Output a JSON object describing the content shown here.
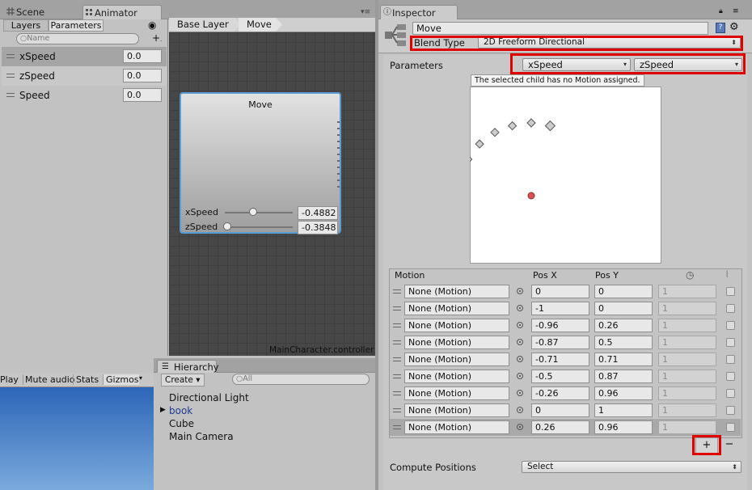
{
  "tabs": {
    "scene": "Scene",
    "animator": "Animator",
    "inspector": "Inspector",
    "hierarchy": "Hierarchy"
  },
  "animator": {
    "subtabs": {
      "layers": "Layers",
      "parameters": "Parameters"
    },
    "search_placeholder": "Name",
    "params": [
      {
        "name": "xSpeed",
        "value": "0.0"
      },
      {
        "name": "zSpeed",
        "value": "0.0"
      },
      {
        "name": "Speed",
        "value": "0.0"
      }
    ],
    "breadcrumb": [
      "Base Layer",
      "Move"
    ],
    "node": {
      "title": "Move",
      "sliders": [
        {
          "label": "xSpeed",
          "value": "-0.4882",
          "pos": 0.3
        },
        {
          "label": "zSpeed",
          "value": "-0.3848",
          "pos": 0.0
        }
      ]
    },
    "controller": "MainCharacter.controller"
  },
  "game_toolbar": {
    "play": "Play",
    "mute": "Mute audio",
    "stats": "Stats",
    "gizmos": "Gizmos"
  },
  "hierarchy": {
    "create": "Create",
    "search_placeholder": "All",
    "items": [
      "Directional Light",
      "book",
      "Cube",
      "Main Camera"
    ]
  },
  "inspector": {
    "name": "Move",
    "blend_type_label": "Blend Type",
    "blend_type": "2D Freeform Directional",
    "parameters_label": "Parameters",
    "param_x": "xSpeed",
    "param_y": "zSpeed",
    "warning": "The selected child has no Motion assigned.",
    "points": [
      [
        0,
        0
      ],
      [
        -1,
        0
      ],
      [
        -0.96,
        0.26
      ],
      [
        -0.87,
        0.5
      ],
      [
        -0.71,
        0.71
      ],
      [
        -0.5,
        0.87
      ],
      [
        -0.26,
        0.96
      ],
      [
        0,
        1
      ],
      [
        0.26,
        0.96
      ]
    ],
    "table_headers": {
      "motion": "Motion",
      "posx": "Pos X",
      "posy": "Pos Y"
    },
    "rows": [
      {
        "motion": "None (Motion)",
        "x": "0",
        "y": "0",
        "speed": "1"
      },
      {
        "motion": "None (Motion)",
        "x": "-1",
        "y": "0",
        "speed": "1"
      },
      {
        "motion": "None (Motion)",
        "x": "-0.96",
        "y": "0.26",
        "speed": "1"
      },
      {
        "motion": "None (Motion)",
        "x": "-0.87",
        "y": "0.5",
        "speed": "1"
      },
      {
        "motion": "None (Motion)",
        "x": "-0.71",
        "y": "0.71",
        "speed": "1"
      },
      {
        "motion": "None (Motion)",
        "x": "-0.5",
        "y": "0.87",
        "speed": "1"
      },
      {
        "motion": "None (Motion)",
        "x": "-0.26",
        "y": "0.96",
        "speed": "1"
      },
      {
        "motion": "None (Motion)",
        "x": "0",
        "y": "1",
        "speed": "1"
      },
      {
        "motion": "None (Motion)",
        "x": "0.26",
        "y": "0.96",
        "speed": "1"
      }
    ],
    "compute_label": "Compute Positions",
    "compute_value": "Select",
    "add_symbol": "+",
    "remove_symbol": "−"
  }
}
